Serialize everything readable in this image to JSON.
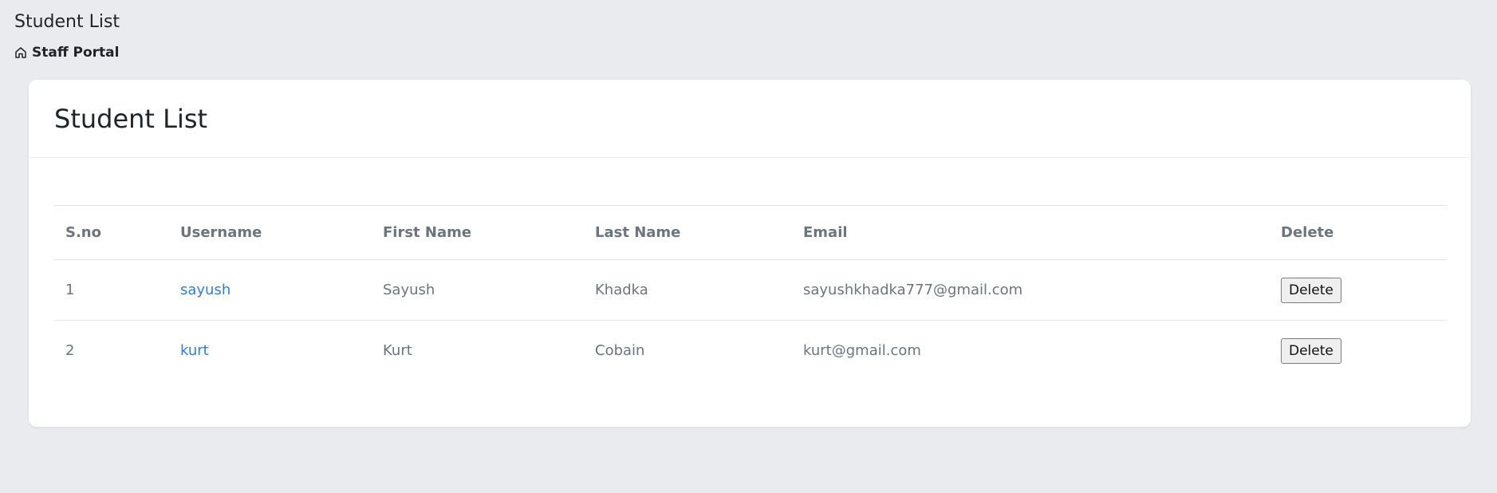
{
  "page": {
    "title": "Student List",
    "breadcrumb_label": "Staff Portal",
    "breadcrumb_icon": "home-icon"
  },
  "card": {
    "title": "Student List"
  },
  "table": {
    "headers": [
      "S.no",
      "Username",
      "First Name",
      "Last Name",
      "Email",
      "Delete"
    ],
    "rows": [
      {
        "sno": "1",
        "username": "sayush",
        "first_name": "Sayush",
        "last_name": "Khadka",
        "email": "sayushkhadka777@gmail.com",
        "delete_label": "Delete"
      },
      {
        "sno": "2",
        "username": "kurt",
        "first_name": "Kurt",
        "last_name": "Cobain",
        "email": "kurt@gmail.com",
        "delete_label": "Delete"
      }
    ]
  },
  "colors": {
    "background": "#e9ebef",
    "link": "#2f7de1",
    "muted_text": "#6c757d"
  }
}
